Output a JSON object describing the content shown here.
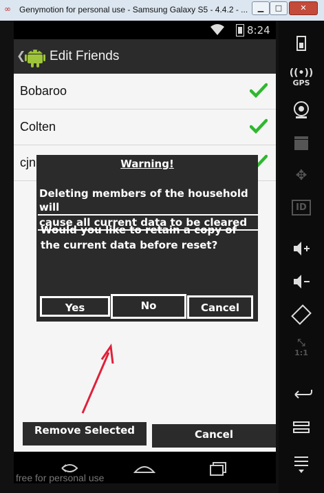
{
  "window": {
    "title": "Genymotion for personal use - Samsung Galaxy S5 - 4.4.2 - ...",
    "minimize": "▁",
    "maximize": "□",
    "close": "✕"
  },
  "status_bar": {
    "time": "8:24"
  },
  "action_bar": {
    "back": "❮",
    "title": "Edit Friends"
  },
  "friends": [
    {
      "name": "Bobaroo",
      "checked": true
    },
    {
      "name": "Colten",
      "checked": true
    },
    {
      "name": "cjn",
      "checked": true
    }
  ],
  "dialog": {
    "title": "Warning!",
    "warning_line1": "Deleting members of the household will",
    "warning_line2": "cause all current data to be cleared",
    "message": "Would you like to retain a copy of the current data before reset?",
    "buttons": {
      "yes": "Yes",
      "no": "No",
      "cancel": "Cancel"
    }
  },
  "bottom_bar": {
    "remove": "Remove Selected",
    "cancel": "Cancel"
  },
  "watermark": "free for personal use",
  "side_panel": {
    "gps_label": "GPS",
    "id_label": "ID",
    "ratio_label": "1:1"
  },
  "colors": {
    "accent_check": "#2eb82e",
    "annotation_arrow": "#e0203a",
    "dialog_bg": "#2b2b2b"
  }
}
